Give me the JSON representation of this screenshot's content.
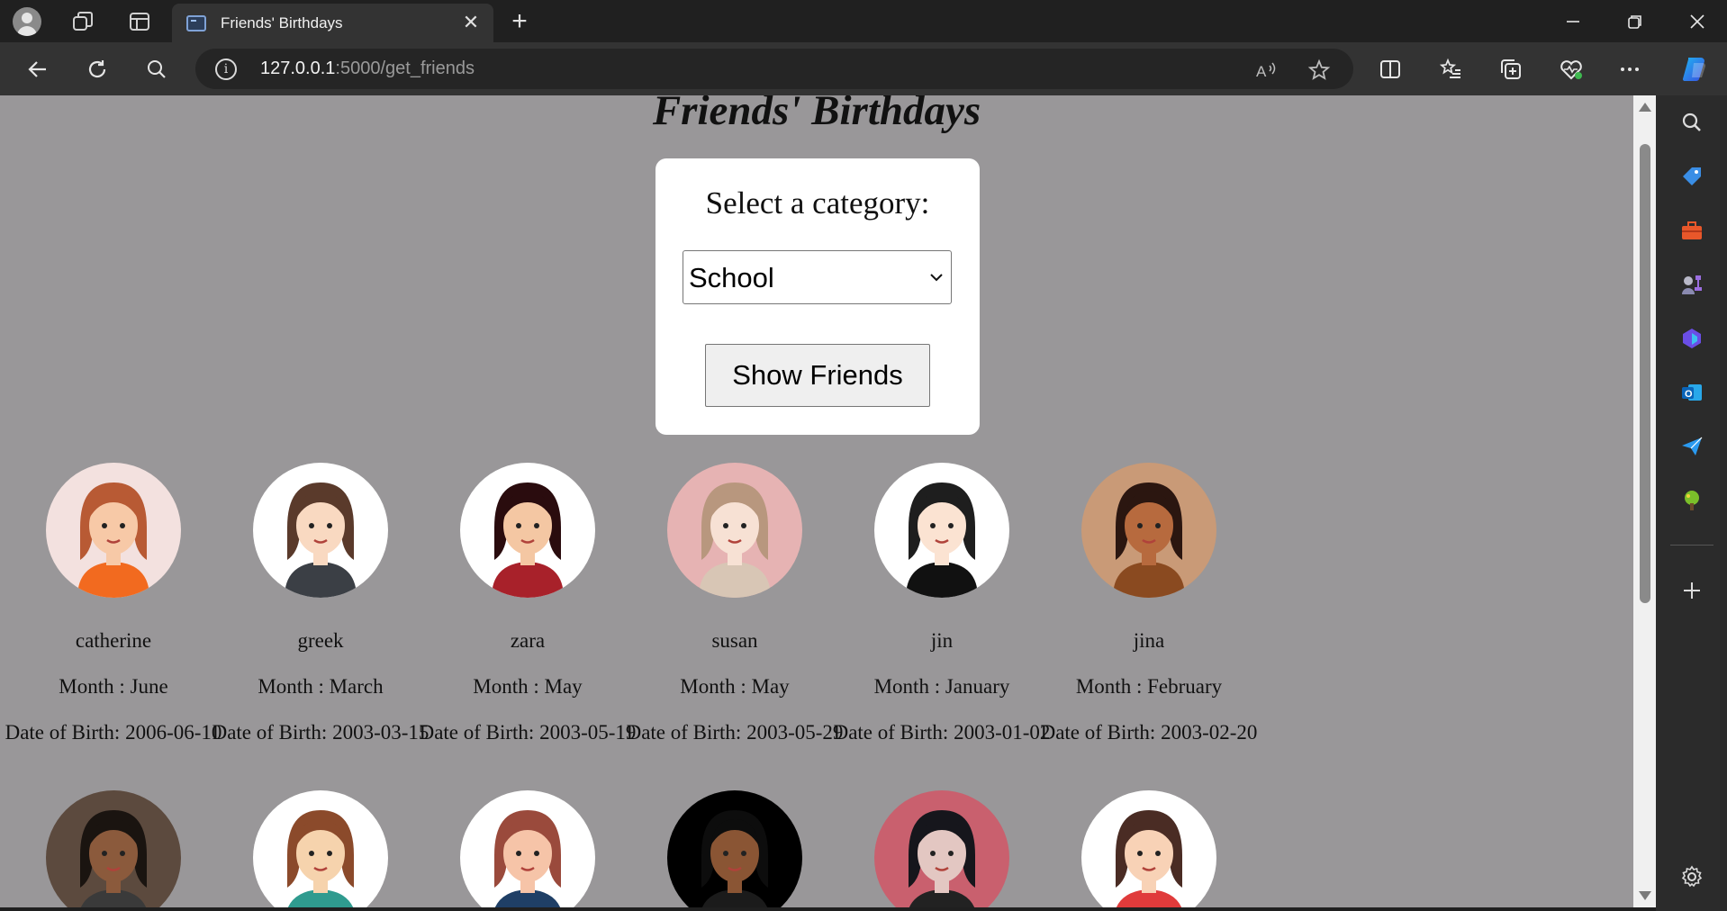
{
  "browser": {
    "tab_title": "Friends' Birthdays",
    "url_host": "127.0.0.1",
    "url_rest": ":5000/get_friends",
    "accent": "#333333"
  },
  "page": {
    "title": "Friends' Birthdays",
    "category_label": "Select a category:",
    "selected_category": "School",
    "show_button": "Show Friends",
    "background": "#999799"
  },
  "friends": [
    {
      "name": "catherine",
      "month": "Month : June",
      "dob": "Date of Birth: 2006-06-10",
      "avatar_bg": "#f3e1df",
      "skin": "#f7c9a7",
      "hair": "#b85a34",
      "shirt": "#f26a1f"
    },
    {
      "name": "greek",
      "month": "Month : March",
      "dob": "Date of Birth: 2003-03-15",
      "avatar_bg": "#ffffff",
      "skin": "#f9d9c1",
      "hair": "#5a3a2b",
      "shirt": "#3b3f45"
    },
    {
      "name": "zara",
      "month": "Month : May",
      "dob": "Date of Birth: 2003-05-19",
      "avatar_bg": "#ffffff",
      "skin": "#f4c7a3",
      "hair": "#2a0c0e",
      "shirt": "#a8212a"
    },
    {
      "name": "susan",
      "month": "Month : May",
      "dob": "Date of Birth: 2003-05-29",
      "avatar_bg": "#e6b3b3",
      "skin": "#f7e1d4",
      "hair": "#b8977e",
      "shirt": "#d8c6b5"
    },
    {
      "name": "jin",
      "month": "Month : January",
      "dob": "Date of Birth: 2003-01-02",
      "avatar_bg": "#ffffff",
      "skin": "#fbe3d2",
      "hair": "#1e1e1e",
      "shirt": "#111111"
    },
    {
      "name": "jina",
      "month": "Month : February",
      "dob": "Date of Birth: 2003-02-20",
      "avatar_bg": "#c99a77",
      "skin": "#b76a3e",
      "hair": "#2b1610",
      "shirt": "#8a4a20"
    }
  ],
  "friends_row2": [
    {
      "avatar_bg": "#5c4a3e",
      "skin": "#8b5a3c",
      "hair": "#1a1410",
      "shirt": "#3a3a3a"
    },
    {
      "avatar_bg": "#ffffff",
      "skin": "#f6d3ad",
      "hair": "#8b4a2b",
      "shirt": "#2f9b8f"
    },
    {
      "avatar_bg": "#ffffff",
      "skin": "#f6c4a8",
      "hair": "#9a4a3c",
      "shirt": "#1f3f66"
    },
    {
      "avatar_bg": "#000000",
      "skin": "#8a5534",
      "hair": "#0d0d0d",
      "shirt": "#1b1b1b"
    },
    {
      "avatar_bg": "#c9606e",
      "skin": "#e3c7c2",
      "hair": "#16161c",
      "shirt": "#222"
    },
    {
      "avatar_bg": "#ffffff",
      "skin": "#f8d2b6",
      "hair": "#4a2c24",
      "shirt": "#e03b3b"
    }
  ],
  "icons": {
    "back": "back-arrow-icon",
    "refresh": "refresh-icon",
    "search": "search-icon",
    "read_aloud": "read-aloud-icon",
    "favorite": "star-icon"
  }
}
